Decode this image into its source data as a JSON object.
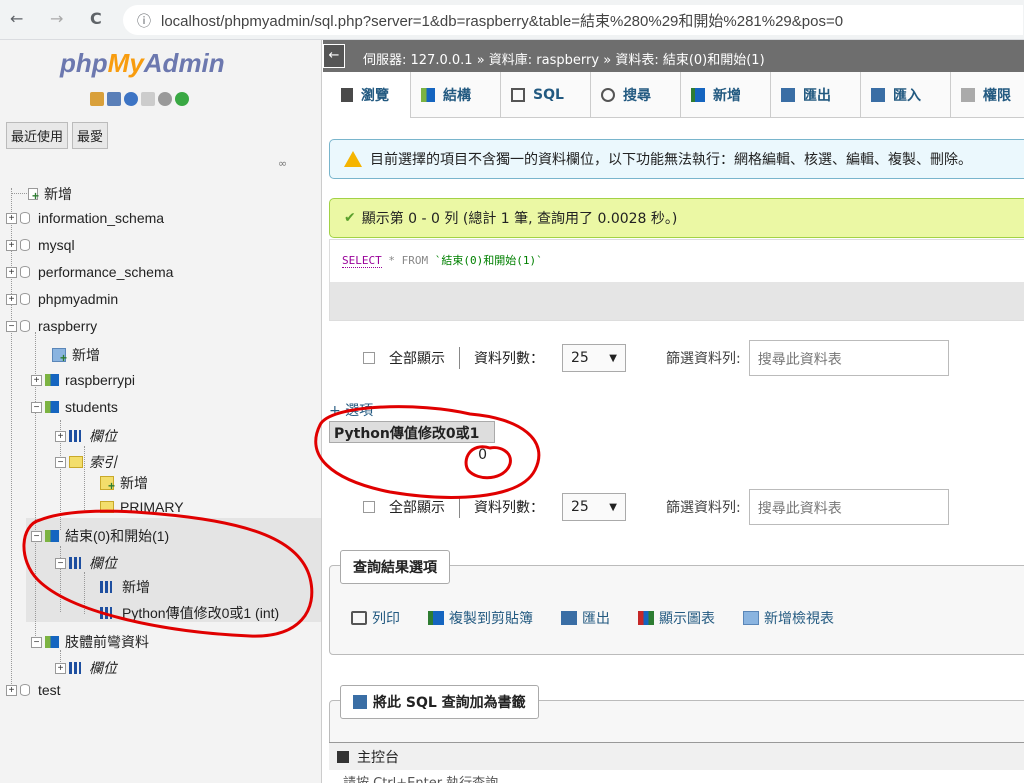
{
  "browser": {
    "back": "←",
    "forward": "→",
    "reload": "C",
    "info_icon": "ⓘ",
    "url": "localhost/phpmyadmin/sql.php?server=1&db=raspberry&table=結束%280%29和開始%281%29&pos=0"
  },
  "sidebar": {
    "logo": {
      "php": "php",
      "my": "My",
      "admin": "Admin"
    },
    "tabs": [
      "最近使用",
      "最愛"
    ],
    "tree": {
      "new": "新增",
      "dbs": {
        "information_schema": "information_schema",
        "mysql": "mysql",
        "performance_schema": "performance_schema",
        "phpmyadmin": "phpmyadmin",
        "raspberry": "raspberry",
        "test": "test"
      },
      "raspberry_new": "新增",
      "raspberrypi": "raspberrypi",
      "students": "students",
      "students_columns": "欄位",
      "students_indexes": "索引",
      "students_index_new": "新增",
      "primary": "PRIMARY",
      "current_table": "結束(0)和開始(1)",
      "current_columns": "欄位",
      "current_col_new": "新增",
      "current_col": "Python傳值修改0或1 (int)",
      "limb_table": "肢體前彎資料",
      "limb_columns": "欄位"
    }
  },
  "breadcrumb": {
    "back": "←",
    "server": "伺服器: 127.0.0.1",
    "db": "資料庫: raspberry",
    "table": "資料表: 結束(0)和開始(1)",
    "sep": "»"
  },
  "tabs": [
    "瀏覽",
    "結構",
    "SQL",
    "搜尋",
    "新增",
    "匯出",
    "匯入",
    "權限"
  ],
  "notice": "目前選擇的項目不含獨一的資料欄位，以下功能無法執行：網格編輯、核選、編輯、複製、刪除。",
  "success": "顯示第 0 - 0 列 (總計 1 筆, 查詢用了 0.0028 秒。)",
  "sql": {
    "select": "SELECT",
    "rest": " * FROM ",
    "table": "`結束(0)和開始(1)`"
  },
  "nav": {
    "show_all": "全部顯示",
    "rows_label": "資料列數：",
    "rows_value": "25",
    "filter_label": "篩選資料列:",
    "filter_placeholder": "搜尋此資料表"
  },
  "result": {
    "options_link": "+ 選項",
    "column": "Python傳值修改0或1",
    "value": "0"
  },
  "query_options": {
    "legend": "查詢結果選項",
    "ops": [
      "列印",
      "複製到剪貼簿",
      "匯出",
      "顯示圖表",
      "新增檢視表"
    ]
  },
  "bookmark": {
    "legend": "將此 SQL 查詢加為書籤"
  },
  "console": {
    "label": "主控台",
    "sub": "請按 Ctrl+Enter 執行查詢"
  },
  "colors": {
    "annotation": "#e00000",
    "link": "#235a81"
  }
}
